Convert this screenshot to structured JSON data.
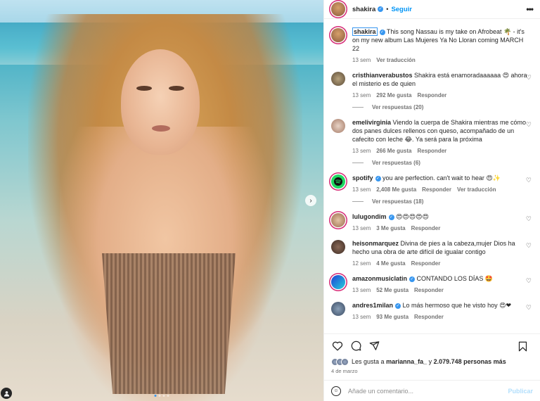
{
  "header": {
    "username": "shakira",
    "separator": "•",
    "follow_label": "Seguir",
    "more_label": "•••"
  },
  "caption": {
    "username": "shakira",
    "text": "This song Nassau is my take on Afrobeat 🌴 - it's on my new album Las Mujeres Ya No Lloran coming MARCH 22",
    "time": "13 sem",
    "translate_label": "Ver traducción"
  },
  "comments": [
    {
      "username": "cristhianverabustos",
      "verified": false,
      "text": "Shakira está enamoradaaaaaa 😍 ahora el misterio es de quien",
      "time": "13 sem",
      "likes": "292 Me gusta",
      "reply_label": "Responder",
      "translate": "",
      "replies": "Ver respuestas (20)"
    },
    {
      "username": "emelivirginia",
      "verified": false,
      "text": "Viendo la cuerpa de Shakira mientras me cómo dos panes dulces rellenos con queso, acompañado de un cafecito con leche 😂. Ya será para la próxima",
      "time": "13 sem",
      "likes": "266 Me gusta",
      "reply_label": "Responder",
      "translate": "",
      "replies": "Ver respuestas (6)"
    },
    {
      "username": "spotify",
      "verified": true,
      "text": "you are perfection. can't wait to hear 😍✨",
      "time": "13 sem",
      "likes": "2,408 Me gusta",
      "reply_label": "Responder",
      "translate": "Ver traducción",
      "replies": "Ver respuestas (18)"
    },
    {
      "username": "lulugondim",
      "verified": true,
      "text": "😍😍😍😍😍",
      "time": "13 sem",
      "likes": "3 Me gusta",
      "reply_label": "Responder",
      "translate": "",
      "replies": ""
    },
    {
      "username": "heisonmarquez",
      "verified": false,
      "text": "Divina de pies a la cabeza,mujer Dios ha hecho una obra de arte difícil de igualar contigo",
      "time": "12 sem",
      "likes": "4 Me gusta",
      "reply_label": "Responder",
      "translate": "",
      "replies": ""
    },
    {
      "username": "amazonmusiclatin",
      "verified": true,
      "text": "CONTANDO LOS DÍAS 🤩",
      "time": "13 sem",
      "likes": "52 Me gusta",
      "reply_label": "Responder",
      "translate": "",
      "replies": ""
    },
    {
      "username": "andres1milan",
      "verified": true,
      "text": "Lo más hermoso que he visto hoy 😍❤",
      "time": "13 sem",
      "likes": "93 Me gusta",
      "reply_label": "Responder",
      "translate": "",
      "replies": ""
    }
  ],
  "likes": {
    "prefix": "Les gusta a",
    "first_user": "marianna_fa_",
    "joiner": "y",
    "count": "2.079.748 personas más"
  },
  "date": "4 de marzo",
  "add_comment": {
    "placeholder": "Añade un comentario...",
    "post_label": "Publicar"
  },
  "icons": {
    "heart": "heart-icon",
    "comment": "comment-icon",
    "share": "share-icon",
    "save": "bookmark-icon",
    "emoji": "emoji-icon",
    "next": "chevron-right-icon",
    "user_tag": "user-tag-icon"
  },
  "colors": {
    "accent": "#0095f6",
    "verified": "#3897f0",
    "muted": "#737373"
  }
}
